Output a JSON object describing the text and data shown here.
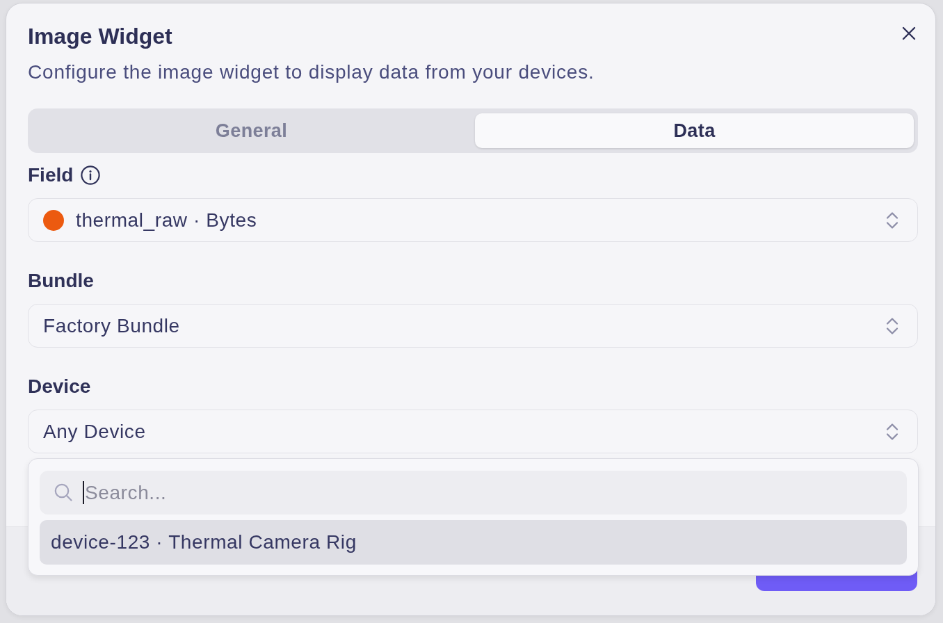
{
  "dialog": {
    "title": "Image Widget",
    "description": "Configure the image widget to display data from your devices."
  },
  "tabs": [
    {
      "label": "General",
      "selected": false
    },
    {
      "label": "Data",
      "selected": true
    }
  ],
  "fields": [
    {
      "label": "Field",
      "kind": "select",
      "info": true,
      "color": "#ec5a10",
      "value": "thermal_raw · Bytes"
    },
    {
      "label": "Bundle",
      "kind": "select",
      "info": false,
      "value": "Factory Bundle"
    },
    {
      "label": "Device",
      "kind": "select",
      "info": false,
      "value": "Any Device",
      "menu": {
        "search": {
          "placeholder": "Search...",
          "focused": true
        },
        "options": [
          {
            "label": "device-123 · Thermal Camera Rig",
            "selected": true
          }
        ]
      }
    }
  ],
  "footer": {
    "buttons": [
      {
        "kind": "primary"
      }
    ]
  }
}
